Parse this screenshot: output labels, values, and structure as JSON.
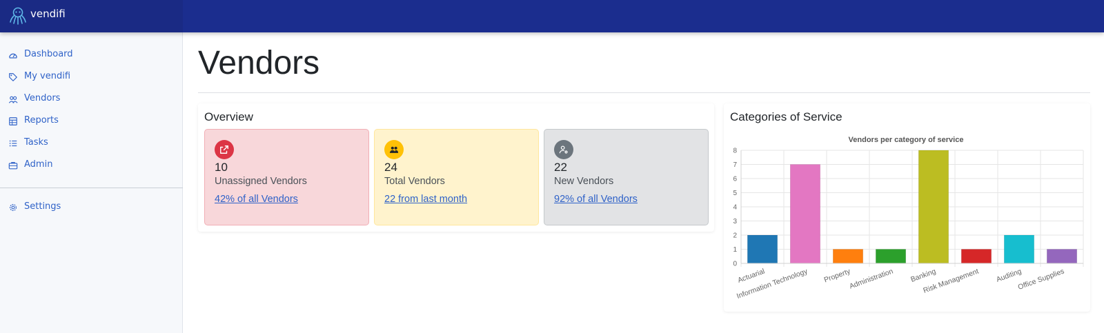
{
  "app": {
    "brand": "vendifi"
  },
  "sidebar": {
    "items": [
      {
        "label": "Dashboard",
        "icon": "gauge-icon"
      },
      {
        "label": "My vendifi",
        "icon": "tag-icon"
      },
      {
        "label": "Vendors",
        "icon": "users-icon"
      },
      {
        "label": "Reports",
        "icon": "table-icon"
      },
      {
        "label": "Tasks",
        "icon": "list-icon"
      },
      {
        "label": "Admin",
        "icon": "briefcase-icon"
      }
    ],
    "settings": {
      "label": "Settings",
      "icon": "gear-icon"
    }
  },
  "page": {
    "title": "Vendors"
  },
  "overview": {
    "title": "Overview",
    "cards": [
      {
        "value": "10",
        "label": "Unassigned Vendors",
        "link": "42% of all Vendors",
        "icon": "external-link-icon",
        "icon_color": "#dc3545",
        "bg": "#f8d7da",
        "border": "#f1aeb5"
      },
      {
        "value": "24",
        "label": "Total Vendors",
        "link": "22 from last month",
        "icon": "people-icon",
        "icon_color": "#ffc107",
        "bg": "#fff3cd",
        "border": "#ffe69c"
      },
      {
        "value": "22",
        "label": "New Vendors",
        "link": "92% of all Vendors",
        "icon": "person-gear-icon",
        "icon_color": "#6c757d",
        "bg": "#e2e3e5",
        "border": "#c4c8cb"
      }
    ]
  },
  "categories_panel": {
    "title": "Categories of Service"
  },
  "chart_data": {
    "type": "bar",
    "title": "Vendors per category of service",
    "categories": [
      "Actuarial",
      "Information Technology",
      "Property",
      "Administration",
      "Banking",
      "Risk Management",
      "Auditing",
      "Office Supplies"
    ],
    "values": [
      2,
      7,
      1,
      1,
      8,
      1,
      2,
      1
    ],
    "colors": [
      "#1f77b4",
      "#e377c2",
      "#ff7f0e",
      "#2ca02c",
      "#bcbd22",
      "#d62728",
      "#17becf",
      "#9467bd"
    ],
    "ylim": [
      0,
      8
    ],
    "yticks": [
      "0",
      "1",
      "2",
      "3",
      "4",
      "5",
      "6",
      "7",
      "8"
    ],
    "grid": true,
    "xlabel": "",
    "ylabel": ""
  }
}
